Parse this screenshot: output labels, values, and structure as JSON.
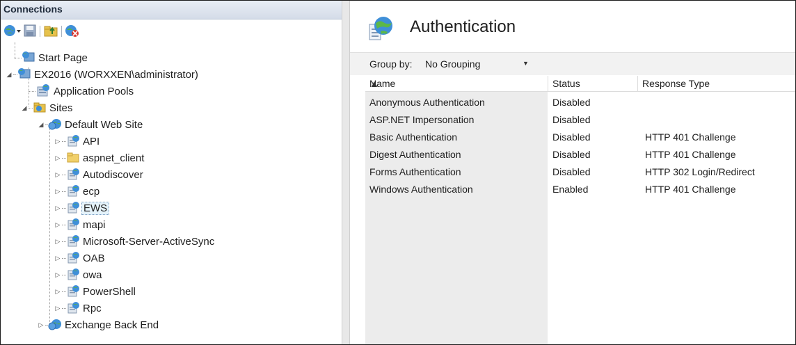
{
  "connections": {
    "title": "Connections"
  },
  "toolbar": {
    "icons": [
      "connect-globe-icon",
      "save-icon",
      "folder-up-icon",
      "disconnect-icon"
    ]
  },
  "tree": {
    "start_page": "Start Page",
    "server": "EX2016 (WORXXEN\\administrator)",
    "app_pools": "Application Pools",
    "sites": "Sites",
    "default_site": "Default Web Site",
    "children": [
      {
        "label": "API",
        "icon": "app-icon"
      },
      {
        "label": "aspnet_client",
        "icon": "folder-icon"
      },
      {
        "label": "Autodiscover",
        "icon": "app-icon"
      },
      {
        "label": "ecp",
        "icon": "app-icon"
      },
      {
        "label": "EWS",
        "icon": "app-icon",
        "selected": true
      },
      {
        "label": "mapi",
        "icon": "app-icon"
      },
      {
        "label": "Microsoft-Server-ActiveSync",
        "icon": "app-icon"
      },
      {
        "label": "OAB",
        "icon": "app-icon"
      },
      {
        "label": "owa",
        "icon": "app-icon"
      },
      {
        "label": "PowerShell",
        "icon": "app-icon"
      },
      {
        "label": "Rpc",
        "icon": "app-icon"
      }
    ],
    "exchange_back_end": "Exchange Back End"
  },
  "page": {
    "title": "Authentication",
    "group_by_label": "Group by:",
    "group_by_value": "No Grouping"
  },
  "table": {
    "columns": [
      "Name",
      "Status",
      "Response Type"
    ],
    "rows": [
      {
        "name": "Anonymous Authentication",
        "status": "Disabled",
        "response": ""
      },
      {
        "name": "ASP.NET Impersonation",
        "status": "Disabled",
        "response": ""
      },
      {
        "name": "Basic Authentication",
        "status": "Disabled",
        "response": "HTTP 401 Challenge"
      },
      {
        "name": "Digest Authentication",
        "status": "Disabled",
        "response": "HTTP 401 Challenge"
      },
      {
        "name": "Forms Authentication",
        "status": "Disabled",
        "response": "HTTP 302 Login/Redirect"
      },
      {
        "name": "Windows Authentication",
        "status": "Enabled",
        "response": "HTTP 401 Challenge"
      }
    ]
  },
  "colors": {
    "header_gradient": "#d4dce8",
    "selection": "#e5f3fb",
    "name_column_bg": "#ececec"
  }
}
